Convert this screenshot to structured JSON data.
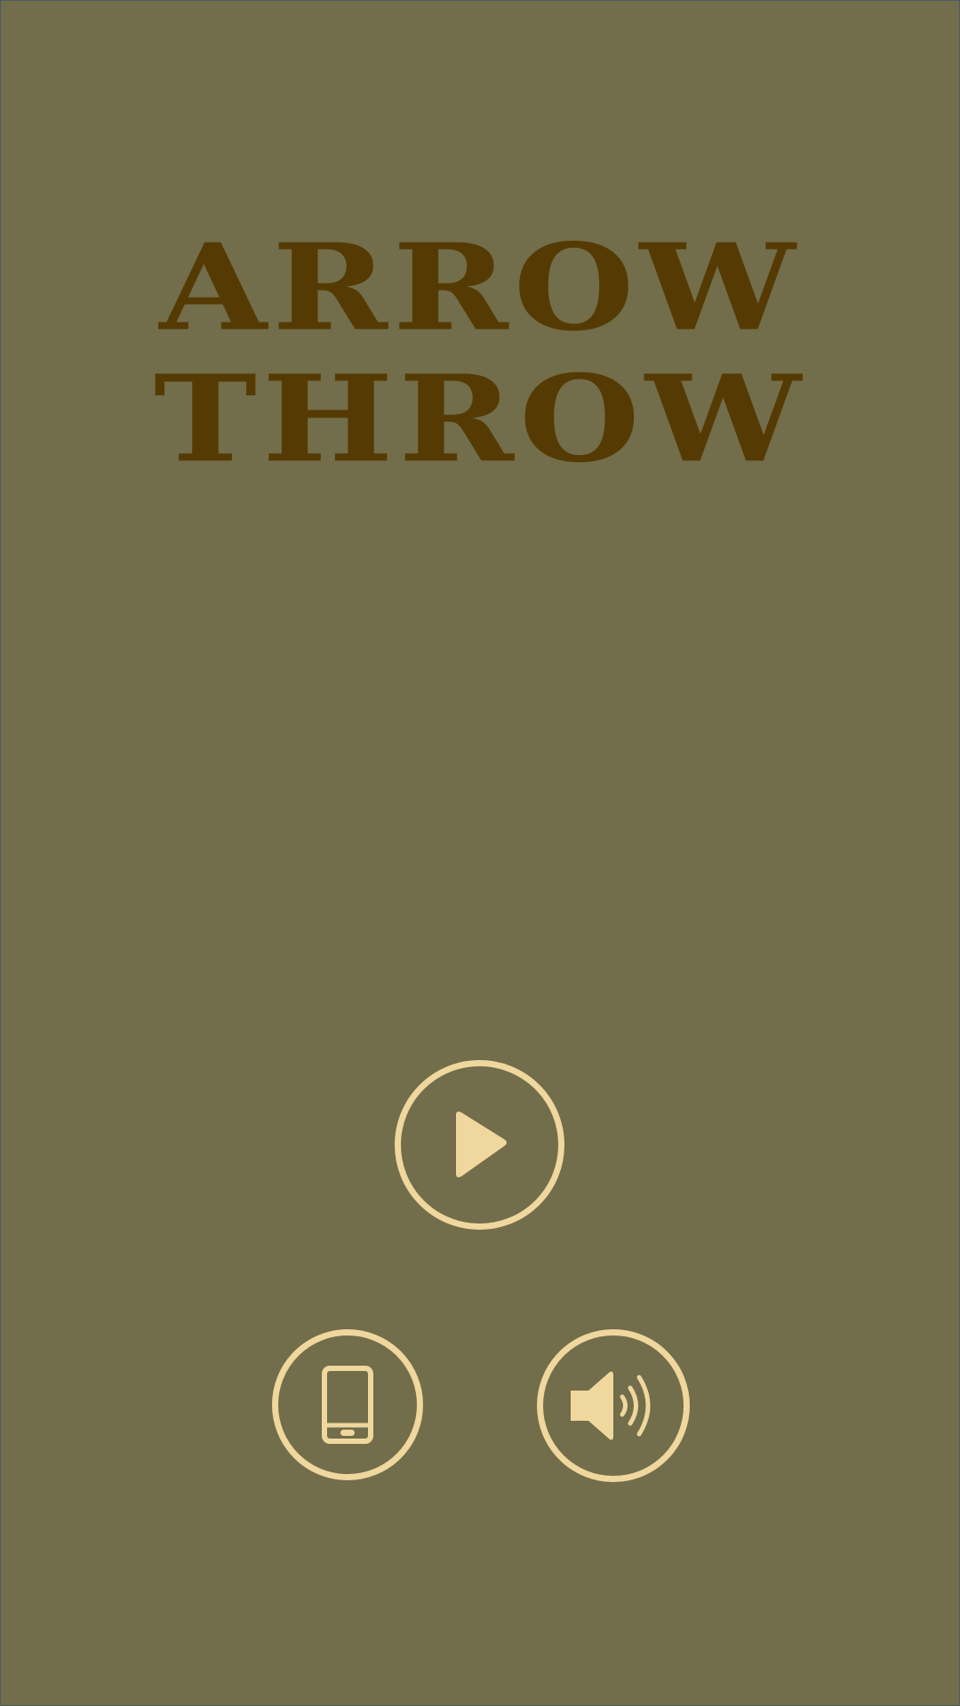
{
  "title": {
    "line1": "ARROW",
    "line2": "THROW"
  },
  "buttons": {
    "play": {
      "icon": "play-icon"
    },
    "device": {
      "icon": "phone-icon"
    },
    "sound": {
      "icon": "speaker-icon"
    }
  },
  "colors": {
    "background": "#726d4a",
    "title": "#553b03",
    "accent": "#efd79d"
  }
}
